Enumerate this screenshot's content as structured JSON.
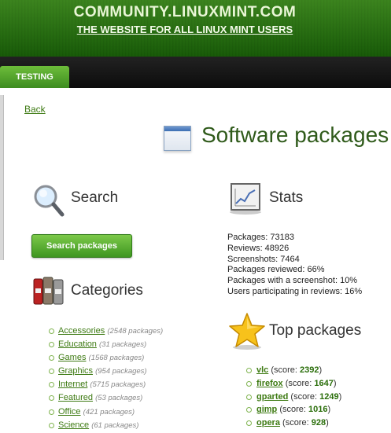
{
  "header": {
    "site_title": "COMMUNITY.LINUXMINT.COM",
    "site_subtitle": "THE WEBSITE FOR ALL LINUX MINT USERS",
    "tab": "TESTING"
  },
  "nav": {
    "back": "Back"
  },
  "page_title": "Software packages",
  "search": {
    "heading": "Search",
    "button": "Search packages"
  },
  "stats": {
    "heading": "Stats",
    "lines": [
      "Packages: 73183",
      "Reviews: 48926",
      "Screenshots: 7464",
      "Packages reviewed: 66%",
      "Packages with a screenshot: 10%",
      "Users participating in reviews: 16%"
    ]
  },
  "categories": {
    "heading": "Categories",
    "items": [
      {
        "name": "Accessories",
        "count": "(2548 packages)"
      },
      {
        "name": "Education",
        "count": "(31 packages)"
      },
      {
        "name": "Games",
        "count": "(1568 packages)"
      },
      {
        "name": "Graphics",
        "count": "(954 packages)"
      },
      {
        "name": "Internet",
        "count": "(5715 packages)"
      },
      {
        "name": "Featured",
        "count": "(53 packages)"
      },
      {
        "name": "Office",
        "count": "(421 packages)"
      },
      {
        "name": "Science",
        "count": "(61 packages)"
      }
    ]
  },
  "top_packages": {
    "heading": "Top packages",
    "score_prefix": "(score: ",
    "score_suffix": ")",
    "items": [
      {
        "name": "vlc",
        "score": "2392"
      },
      {
        "name": "firefox",
        "score": "1647"
      },
      {
        "name": "gparted",
        "score": "1249"
      },
      {
        "name": "gimp",
        "score": "1016"
      },
      {
        "name": "opera",
        "score": "928"
      }
    ]
  },
  "icons": {
    "package": "window-icon",
    "search": "magnifier-icon",
    "stats": "chart-icon",
    "categories": "books-icon",
    "top": "star-icon"
  }
}
